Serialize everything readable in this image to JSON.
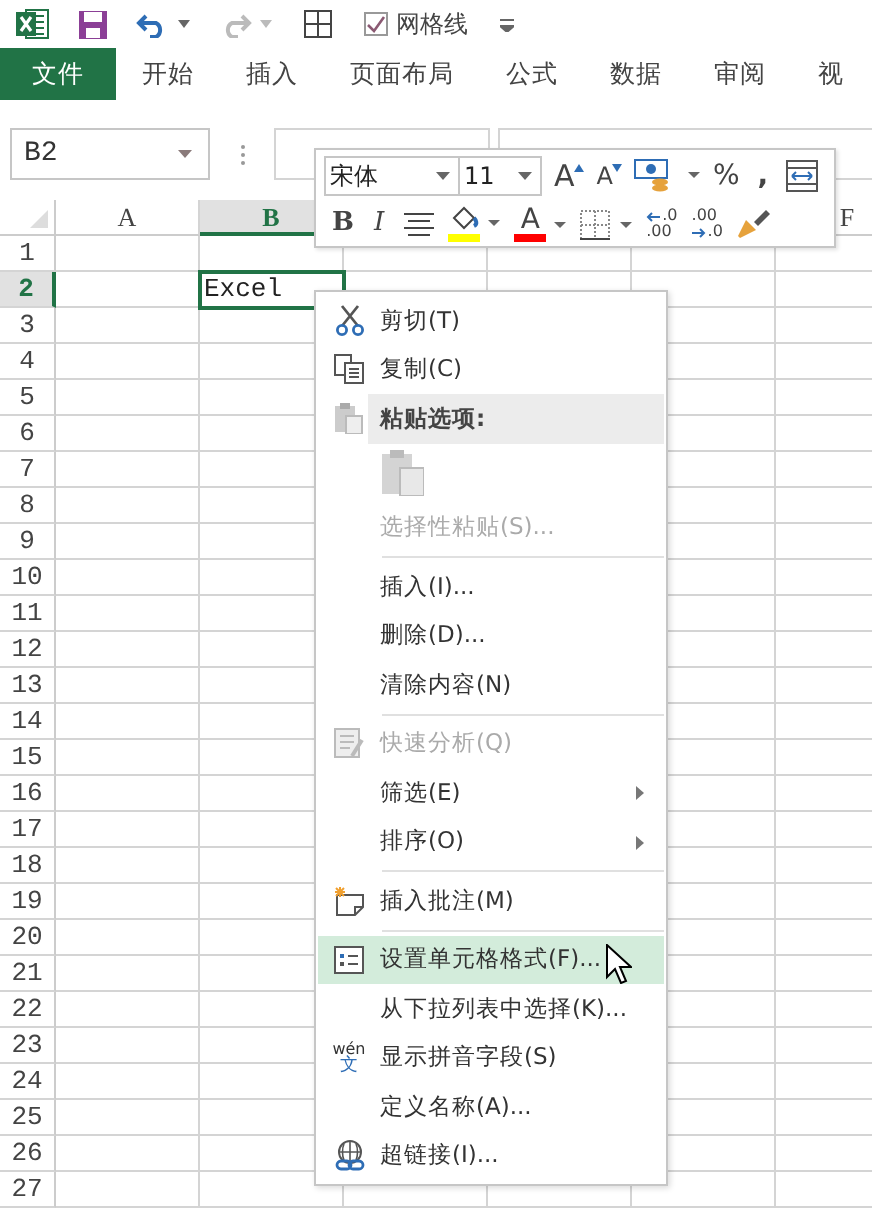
{
  "quick_access": {
    "gridlines_label": "网格线",
    "gridlines_checked": true,
    "redo_disabled": true
  },
  "ribbon_tabs": [
    {
      "label": "文件",
      "selected": true
    },
    {
      "label": "开始",
      "selected": false
    },
    {
      "label": "插入",
      "selected": false
    },
    {
      "label": "页面布局",
      "selected": false
    },
    {
      "label": "公式",
      "selected": false
    },
    {
      "label": "数据",
      "selected": false
    },
    {
      "label": "审阅",
      "selected": false
    },
    {
      "label": "视",
      "selected": false
    }
  ],
  "name_box": {
    "value": "B2"
  },
  "columns": [
    {
      "label": "A",
      "selected": false
    },
    {
      "label": "B",
      "selected": true
    },
    {
      "label": "F",
      "selected": false
    }
  ],
  "rows": [
    {
      "label": "1",
      "selected": false
    },
    {
      "label": "2",
      "selected": true,
      "cell_b": "Excel"
    },
    {
      "label": "3",
      "selected": false
    },
    {
      "label": "4",
      "selected": false
    },
    {
      "label": "5",
      "selected": false
    },
    {
      "label": "6",
      "selected": false
    },
    {
      "label": "7",
      "selected": false
    },
    {
      "label": "8",
      "selected": false
    },
    {
      "label": "9",
      "selected": false
    },
    {
      "label": "10",
      "selected": false
    },
    {
      "label": "11",
      "selected": false
    },
    {
      "label": "12",
      "selected": false
    },
    {
      "label": "13",
      "selected": false
    },
    {
      "label": "14",
      "selected": false
    },
    {
      "label": "15",
      "selected": false
    },
    {
      "label": "16",
      "selected": false
    },
    {
      "label": "17",
      "selected": false
    },
    {
      "label": "18",
      "selected": false
    },
    {
      "label": "19",
      "selected": false
    },
    {
      "label": "20",
      "selected": false
    },
    {
      "label": "21",
      "selected": false
    },
    {
      "label": "22",
      "selected": false
    },
    {
      "label": "23",
      "selected": false
    },
    {
      "label": "24",
      "selected": false
    },
    {
      "label": "25",
      "selected": false
    },
    {
      "label": "26",
      "selected": false
    },
    {
      "label": "27",
      "selected": false
    }
  ],
  "mini_toolbar": {
    "font": "宋体",
    "size": "11",
    "row_1": [
      {
        "kind": "grow_font",
        "label": "A"
      },
      {
        "kind": "shrink_font",
        "label": "A"
      },
      {
        "kind": "accounting"
      },
      {
        "kind": "percent",
        "label": "%"
      },
      {
        "kind": "comma",
        "label": ","
      },
      {
        "kind": "format_table"
      }
    ],
    "row_2": [
      {
        "kind": "bold",
        "label": "B"
      },
      {
        "kind": "italic",
        "label": "I"
      },
      {
        "kind": "center"
      },
      {
        "kind": "fill_color",
        "color": "#ffff00"
      },
      {
        "kind": "font_color",
        "label": "A",
        "color": "#ff0000"
      },
      {
        "kind": "borders"
      },
      {
        "kind": "increase_decimal",
        "top": ".0",
        "bottom": ".00"
      },
      {
        "kind": "decrease_decimal",
        "top": ".00",
        "bottom": ".0"
      },
      {
        "kind": "format_painter"
      }
    ]
  },
  "context_menu": [
    {
      "kind": "cut",
      "label": "剪切(T)",
      "disabled": false,
      "selected": false
    },
    {
      "kind": "copy",
      "label": "复制(C)",
      "disabled": false,
      "selected": false
    },
    {
      "kind": "paste_header",
      "label": "粘贴选项:"
    },
    {
      "kind": "paste_options",
      "disabled": true
    },
    {
      "kind": "command",
      "label": "选择性粘贴(S)...",
      "disabled": true,
      "selected": false
    },
    {
      "kind": "separator"
    },
    {
      "kind": "command",
      "label": "插入(I)...",
      "disabled": false,
      "selected": false
    },
    {
      "kind": "command",
      "label": "删除(D)...",
      "disabled": false,
      "selected": false
    },
    {
      "kind": "command",
      "label": "清除内容(N)",
      "disabled": false,
      "selected": false
    },
    {
      "kind": "separator"
    },
    {
      "kind": "analysis",
      "label": "快速分析(Q)",
      "disabled": true,
      "selected": false
    },
    {
      "kind": "submenu",
      "label": "筛选(E)",
      "disabled": false,
      "selected": false
    },
    {
      "kind": "submenu",
      "label": "排序(O)",
      "disabled": false,
      "selected": false
    },
    {
      "kind": "separator"
    },
    {
      "kind": "comment",
      "label": "插入批注(M)",
      "disabled": false,
      "selected": false
    },
    {
      "kind": "separator"
    },
    {
      "kind": "format",
      "label": "设置单元格格式(F)...",
      "disabled": false,
      "selected": true
    },
    {
      "kind": "command",
      "label": "从下拉列表中选择(K)...",
      "disabled": false,
      "selected": false
    },
    {
      "kind": "pinyin",
      "label": "显示拼音字段(S)",
      "icon_top": "wén",
      "icon_bottom": "文",
      "disabled": false,
      "selected": false
    },
    {
      "kind": "command",
      "label": "定义名称(A)...",
      "disabled": false,
      "selected": false
    },
    {
      "kind": "link",
      "label": "超链接(I)...",
      "disabled": false,
      "selected": false
    }
  ]
}
